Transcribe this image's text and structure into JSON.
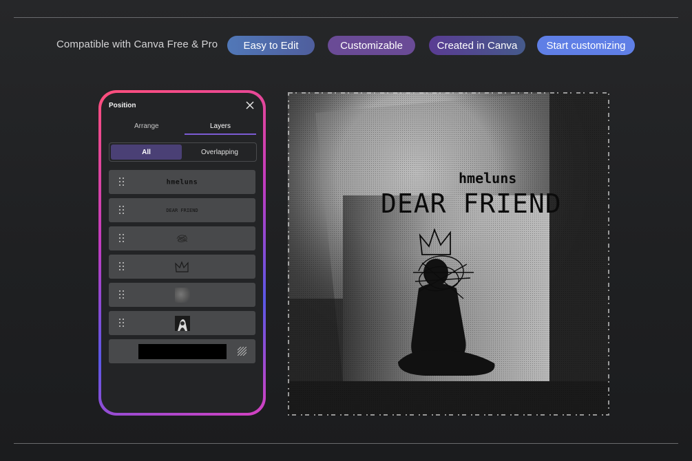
{
  "header": {
    "compat_text": "Compatible with Canva Free & Pro",
    "badges": [
      "Easy to Edit",
      "Customizable",
      "Created in Canva"
    ],
    "cta_label": "Start customizing"
  },
  "panel": {
    "title": "Position",
    "tabs": [
      {
        "label": "Arrange",
        "active": false
      },
      {
        "label": "Layers",
        "active": true
      }
    ],
    "filters": [
      {
        "label": "All",
        "active": true
      },
      {
        "label": "Overlapping",
        "active": false
      }
    ],
    "layers": [
      {
        "type": "text",
        "preview": "hmeluns"
      },
      {
        "type": "text",
        "preview": "DEAR FRIEND"
      },
      {
        "type": "graphic",
        "icon": "scribble-icon"
      },
      {
        "type": "graphic",
        "icon": "crown-icon"
      },
      {
        "type": "image",
        "icon": "smoke-texture"
      },
      {
        "type": "image",
        "icon": "photo-thumbnail"
      },
      {
        "type": "background",
        "icon": "transparency-icon"
      }
    ]
  },
  "artwork": {
    "artist": "hmeluns",
    "title": "DEAR FRIEND"
  },
  "colors": {
    "accent": "#7d5bd4",
    "cta": "#5f7fe6",
    "background": "#222325"
  }
}
